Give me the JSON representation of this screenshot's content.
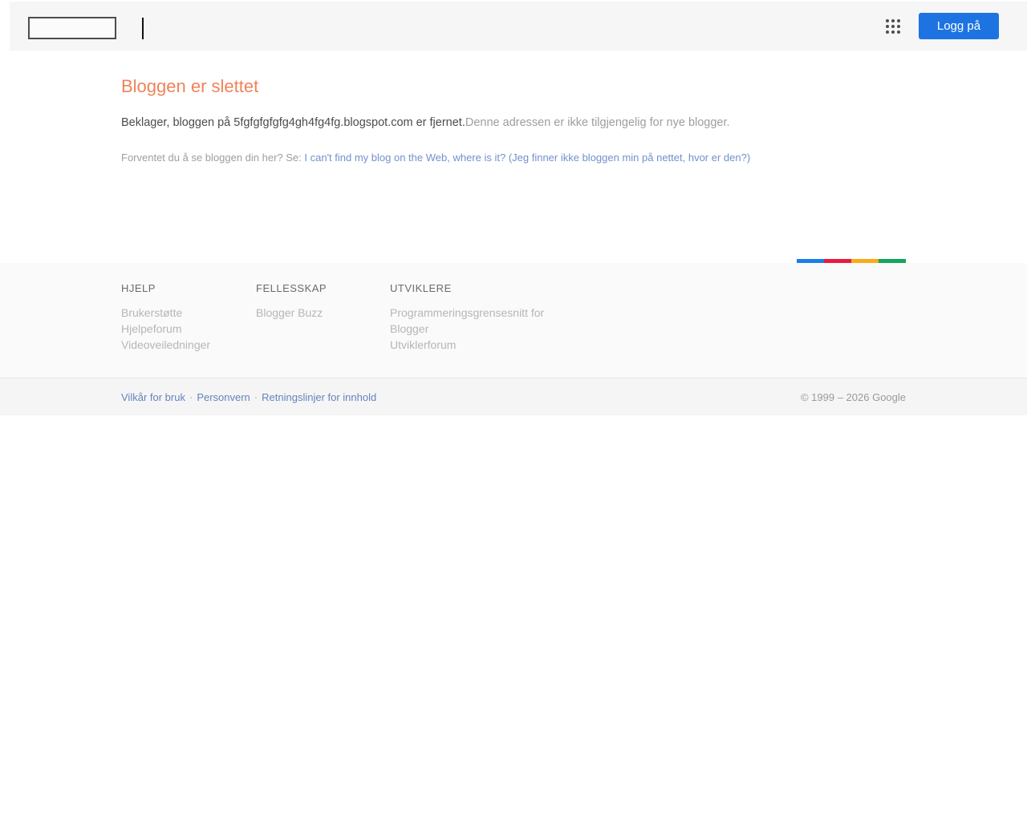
{
  "header": {
    "signin_label": "Logg på"
  },
  "main": {
    "title": "Bloggen er slettet",
    "message_primary": "Beklager, bloggen på 5fgfgfgfgfg4gh4fg4fg.blogspot.com er fjernet.",
    "message_secondary": "Denne adressen er ikke tilgjengelig for nye blogger.",
    "help_prompt": "Forventet du å se bloggen din her? Se: ",
    "help_link": "I can't find my blog on the Web, where is it? (Jeg finner ikke bloggen min på nettet, hvor er den?)"
  },
  "footer": {
    "accent_colors": [
      "#1a80e8",
      "#e81c3f",
      "#fbab18",
      "#15a55c"
    ],
    "columns": [
      {
        "heading": "HJELP",
        "links": [
          "Brukerstøtte",
          "Hjelpeforum",
          "Videoveiledninger"
        ]
      },
      {
        "heading": "FELLESSKAP",
        "links": [
          "Blogger Buzz"
        ]
      },
      {
        "heading": "UTVIKLERE",
        "links": [
          "Programmeringsgrensesnitt for Blogger",
          "Utviklerforum"
        ]
      }
    ]
  },
  "bottombar": {
    "links": [
      "Vilkår for bruk",
      "Personvern",
      "Retningslinjer for innhold"
    ],
    "separator": "·",
    "copyright": "© 1999 – 2026 Google"
  }
}
